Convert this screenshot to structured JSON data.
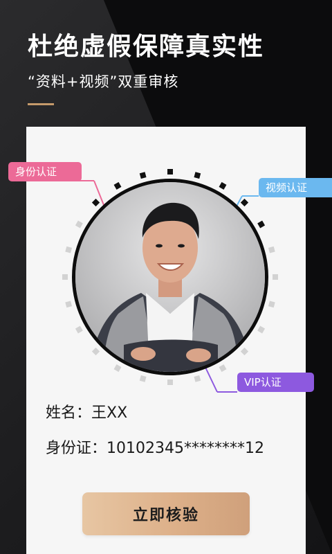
{
  "header": {
    "title": "杜绝虚假保障真实性",
    "subtitle": "“资料+视频”双重审核"
  },
  "tags": {
    "id_auth": "身份认证",
    "video_auth": "视频认证",
    "vip_auth": "VIP认证"
  },
  "profile": {
    "name_row": "姓名：王XX",
    "id_row": "身份证：10102345********12"
  },
  "actions": {
    "verify_label": "立即核验"
  },
  "colors": {
    "accent": "#c59a6b",
    "id_tag": "#ec6a97",
    "video_tag": "#6bb8ef",
    "vip_tag": "#8d59df",
    "button": "#ddb089"
  },
  "icons": {
    "avatar": "person-portrait"
  }
}
